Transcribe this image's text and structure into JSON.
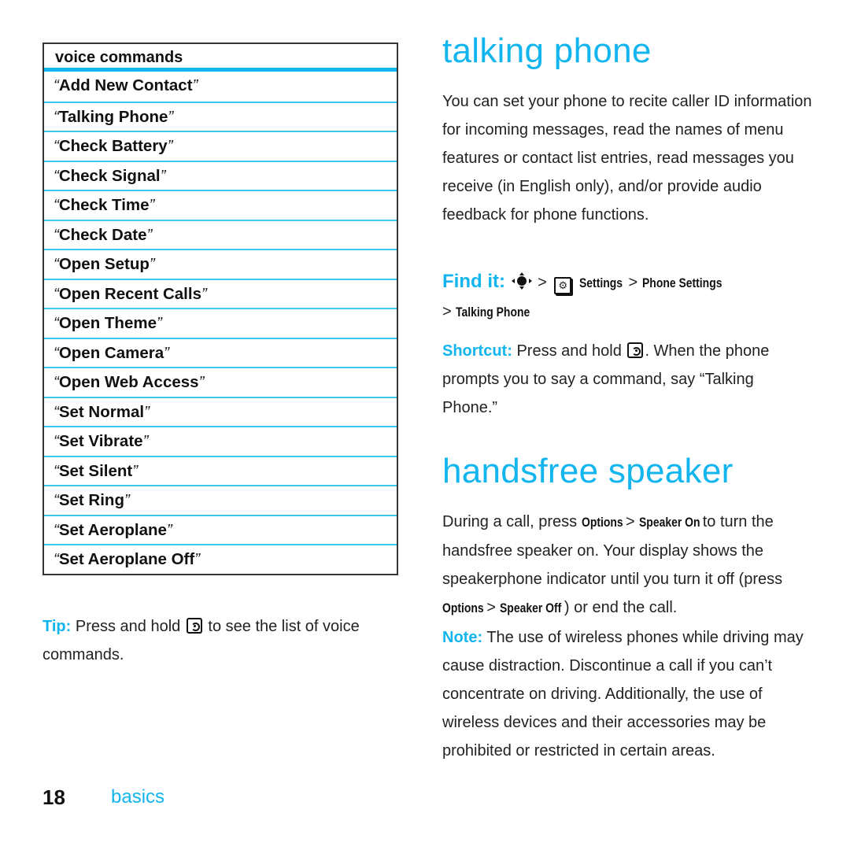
{
  "voice_commands": {
    "header": "voice commands",
    "items": [
      "Add New Contact",
      "Talking Phone",
      "Check Battery",
      "Check Signal",
      "Check Time",
      "Check Date",
      "Open Setup",
      "Open Recent Calls",
      "Open Theme",
      "Open Camera",
      "Open Web Access",
      "Set Normal",
      "Set Vibrate",
      "Set Silent",
      "Set Ring",
      "Set Aeroplane",
      "Set Aeroplane Off"
    ],
    "open_quote": "“",
    "close_quote": "”"
  },
  "tip": {
    "label": "Tip:",
    "text_before": "Press and hold",
    "text_after": "to see the list of voice commands.",
    "key_icon": "voice-key-icon"
  },
  "talking_phone": {
    "title": "talking phone",
    "body": "You can set your phone to recite caller ID information for incoming messages, read the names of menu features or contact list entries, read messages you receive (in English only), and/or provide audio feedback for phone functions.",
    "find_it": {
      "label": "Find it:",
      "nav_icon": "nav-key-icon",
      "sep": ">",
      "menu_icon": "menu-key-icon",
      "path": [
        "Settings",
        "Phone Settings",
        "Talking Phone"
      ]
    },
    "shortcut": {
      "label": "Shortcut:",
      "text_before": "Press and hold",
      "text_after": ". When the phone prompts you to say a command, say “Talking Phone.”"
    }
  },
  "handsfree": {
    "title": "handsfree speaker",
    "p1_a": "During a call, press",
    "options": "Options",
    "sep": ">",
    "speaker_on": "Speaker On",
    "p1_b": "to turn the handsfree speaker on. Your display shows the speakerphone indicator until you turn it off (press",
    "speaker_off": "Speaker Off",
    "p1_c": ") or end the call.",
    "note_label": "Note:",
    "note_text": "The use of wireless phones while driving may cause distraction. Discontinue a call if you can’t concentrate on driving. Additionally, the use of wireless devices and their accessories may be prohibited or restricted in certain areas."
  },
  "footer": {
    "page_number": "18",
    "section": "basics"
  },
  "colors": {
    "accent": "#12b5ee",
    "text": "#222222"
  }
}
